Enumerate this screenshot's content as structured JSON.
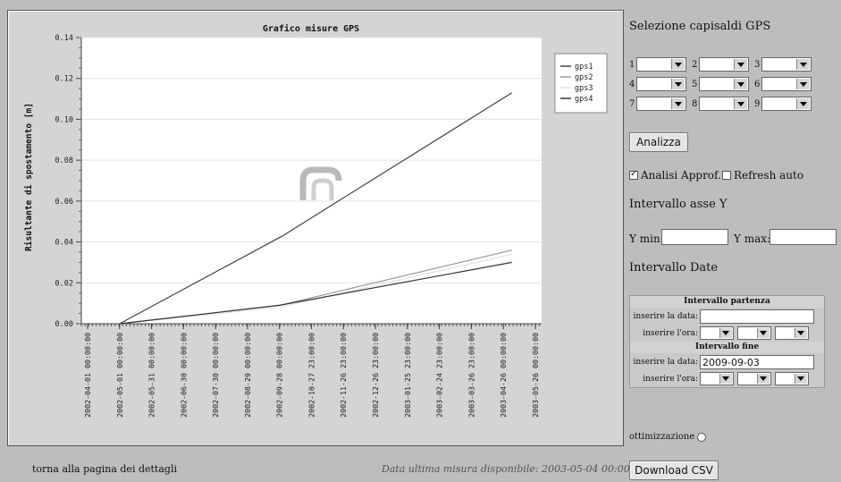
{
  "chart_data": {
    "type": "line",
    "title": "Grafico misure GPS",
    "ylabel": "Risultante di spostamento [m]",
    "xlabel": "",
    "ylim": [
      0,
      0.14
    ],
    "yticks": [
      "0.00",
      "0.02",
      "0.04",
      "0.06",
      "0.08",
      "0.10",
      "0.12",
      "0.14"
    ],
    "xticks": [
      "2002-04-01 00:00:00",
      "2002-05-01 00:00:00",
      "2002-05-31 00:00:00",
      "2002-06-30 00:00:00",
      "2002-07-30 00:00:00",
      "2002-08-29 00:00:00",
      "2002-09-28 00:00:00",
      "2002-10-27 23:00:00",
      "2002-11-26 23:00:00",
      "2002-12-26 23:00:00",
      "2003-01-25 23:00:00",
      "2003-02-24 23:00:00",
      "2003-03-26 23:00:00",
      "2003-04-26 00:00:00",
      "2003-05-26 00:00:00"
    ],
    "grid": true,
    "legend_position": "top-right",
    "series": [
      {
        "name": "gps1",
        "color": "#444444",
        "points": [
          [
            "2002-05-01",
            0.0
          ],
          [
            "2002-10-01",
            0.043
          ],
          [
            "2003-05-04",
            0.113
          ]
        ]
      },
      {
        "name": "gps2",
        "color": "#9a9a9a",
        "points": [
          [
            "2002-05-01",
            0.0
          ],
          [
            "2002-09-28",
            0.009
          ],
          [
            "2003-05-04",
            0.036
          ]
        ]
      },
      {
        "name": "gps3",
        "color": "#e2e2e2",
        "points": [
          [
            "2002-05-01",
            0.0
          ],
          [
            "2002-09-28",
            0.008
          ],
          [
            "2003-05-04",
            0.034
          ]
        ]
      },
      {
        "name": "gps4",
        "color": "#333333",
        "points": [
          [
            "2002-05-01",
            0.0
          ],
          [
            "2002-09-28",
            0.009
          ],
          [
            "2003-05-04",
            0.03
          ]
        ]
      }
    ]
  },
  "footer": {
    "back_link": "torna alla pagina dei dettagli",
    "last_measure": "Data ultima misura disponibile: 2003-05-04 00:00:00"
  },
  "panel": {
    "title": "Selezione capisaldi GPS",
    "selectors": [
      "1",
      "2",
      "3",
      "4",
      "5",
      "6",
      "7",
      "8",
      "9"
    ],
    "analyze_button": "Analizza",
    "analisi_label": "Analisi Approf.",
    "analisi_checked": true,
    "refresh_label": "Refresh auto",
    "refresh_checked": false,
    "y_range_title": "Intervallo asse Y",
    "ymin_label": "Y min:",
    "ymin_value": "",
    "ymax_label": "Y max:",
    "ymax_value": "",
    "date_range_title": "Intervallo Date",
    "start_header": "Intervallo partenza",
    "date_label": "inserire la data:",
    "start_date_value": "",
    "time_label": "inserire l'ora:",
    "end_header": "Intervallo fine",
    "end_date_value": "2009-09-03",
    "optimization_label": "ottimizzazione",
    "download_button": "Download CSV"
  }
}
